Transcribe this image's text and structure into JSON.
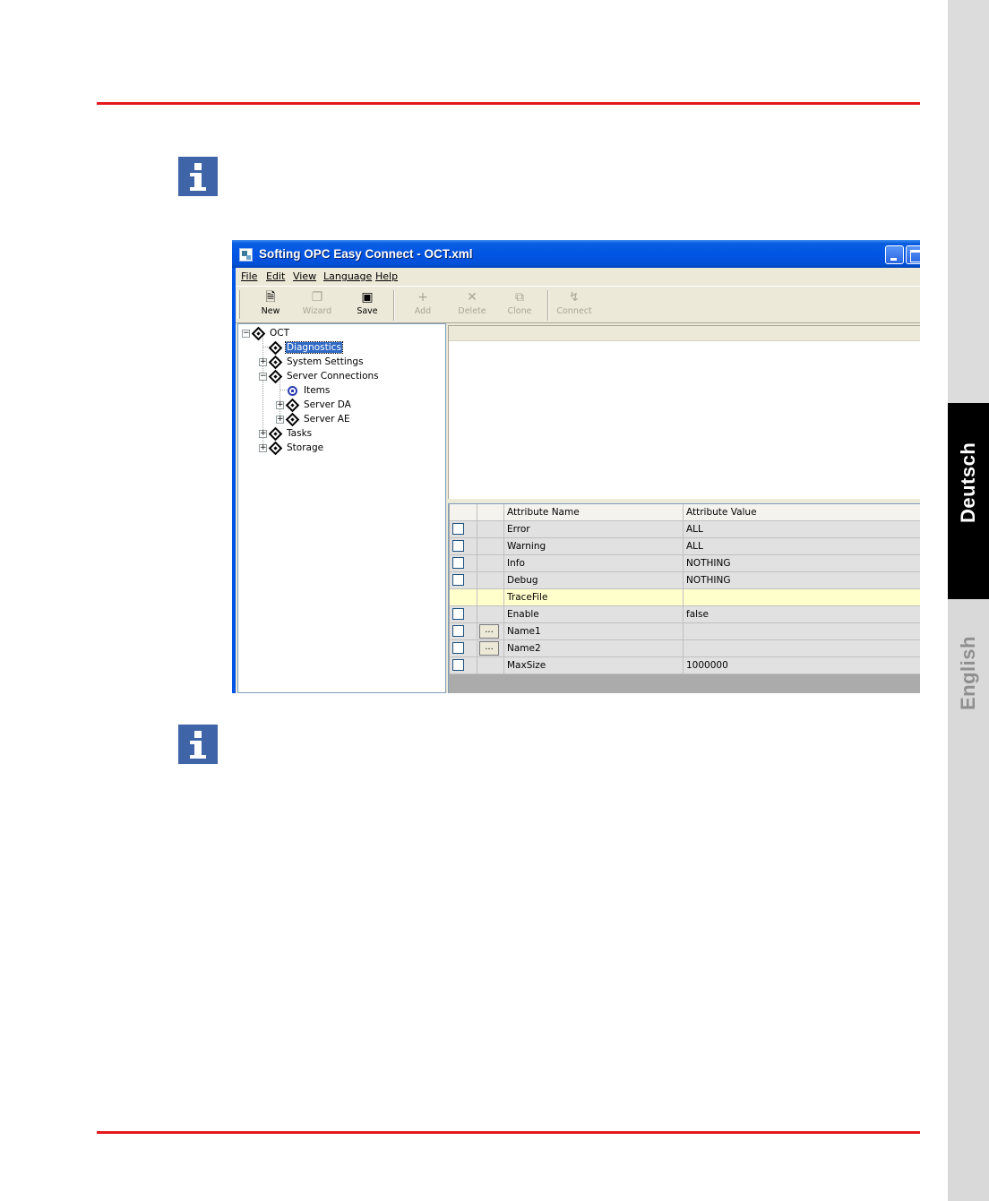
{
  "side_tabs": {
    "deutsch": "Deutsch",
    "english": "English"
  },
  "window": {
    "title": "Softing OPC Easy Connect - OCT.xml"
  },
  "menu": [
    "File",
    "Edit",
    "View",
    "Language",
    "Help"
  ],
  "toolbar": {
    "new": "New",
    "wizard": "Wizard",
    "save": "Save",
    "add": "Add",
    "delete": "Delete",
    "clone": "Clone",
    "connect": "Connect"
  },
  "tree": [
    {
      "label": "OCT",
      "expander": "−"
    },
    {
      "label": "Diagnostics",
      "selected": true
    },
    {
      "label": "System Settings",
      "expander": "+"
    },
    {
      "label": "Server Connections",
      "expander": "−"
    },
    {
      "label": "Items"
    },
    {
      "label": "Server DA",
      "expander": "+"
    },
    {
      "label": "Server AE",
      "expander": "+"
    },
    {
      "label": "Tasks",
      "expander": "+"
    },
    {
      "label": "Storage",
      "expander": "+"
    }
  ],
  "grid": {
    "columns": [
      "Attribute Name",
      "Attribute Value"
    ],
    "rows": [
      {
        "name": "Error",
        "value": "ALL"
      },
      {
        "name": "Warning",
        "value": "ALL"
      },
      {
        "name": "Info",
        "value": "NOTHING"
      },
      {
        "name": "Debug",
        "value": "NOTHING"
      },
      {
        "name": "TraceFile",
        "value": ""
      },
      {
        "name": "Enable",
        "value": "false"
      },
      {
        "name": "Name1",
        "value": ""
      },
      {
        "name": "Name2",
        "value": ""
      },
      {
        "name": "MaxSize",
        "value": "1000000"
      }
    ],
    "ellipsis_label": "..."
  }
}
